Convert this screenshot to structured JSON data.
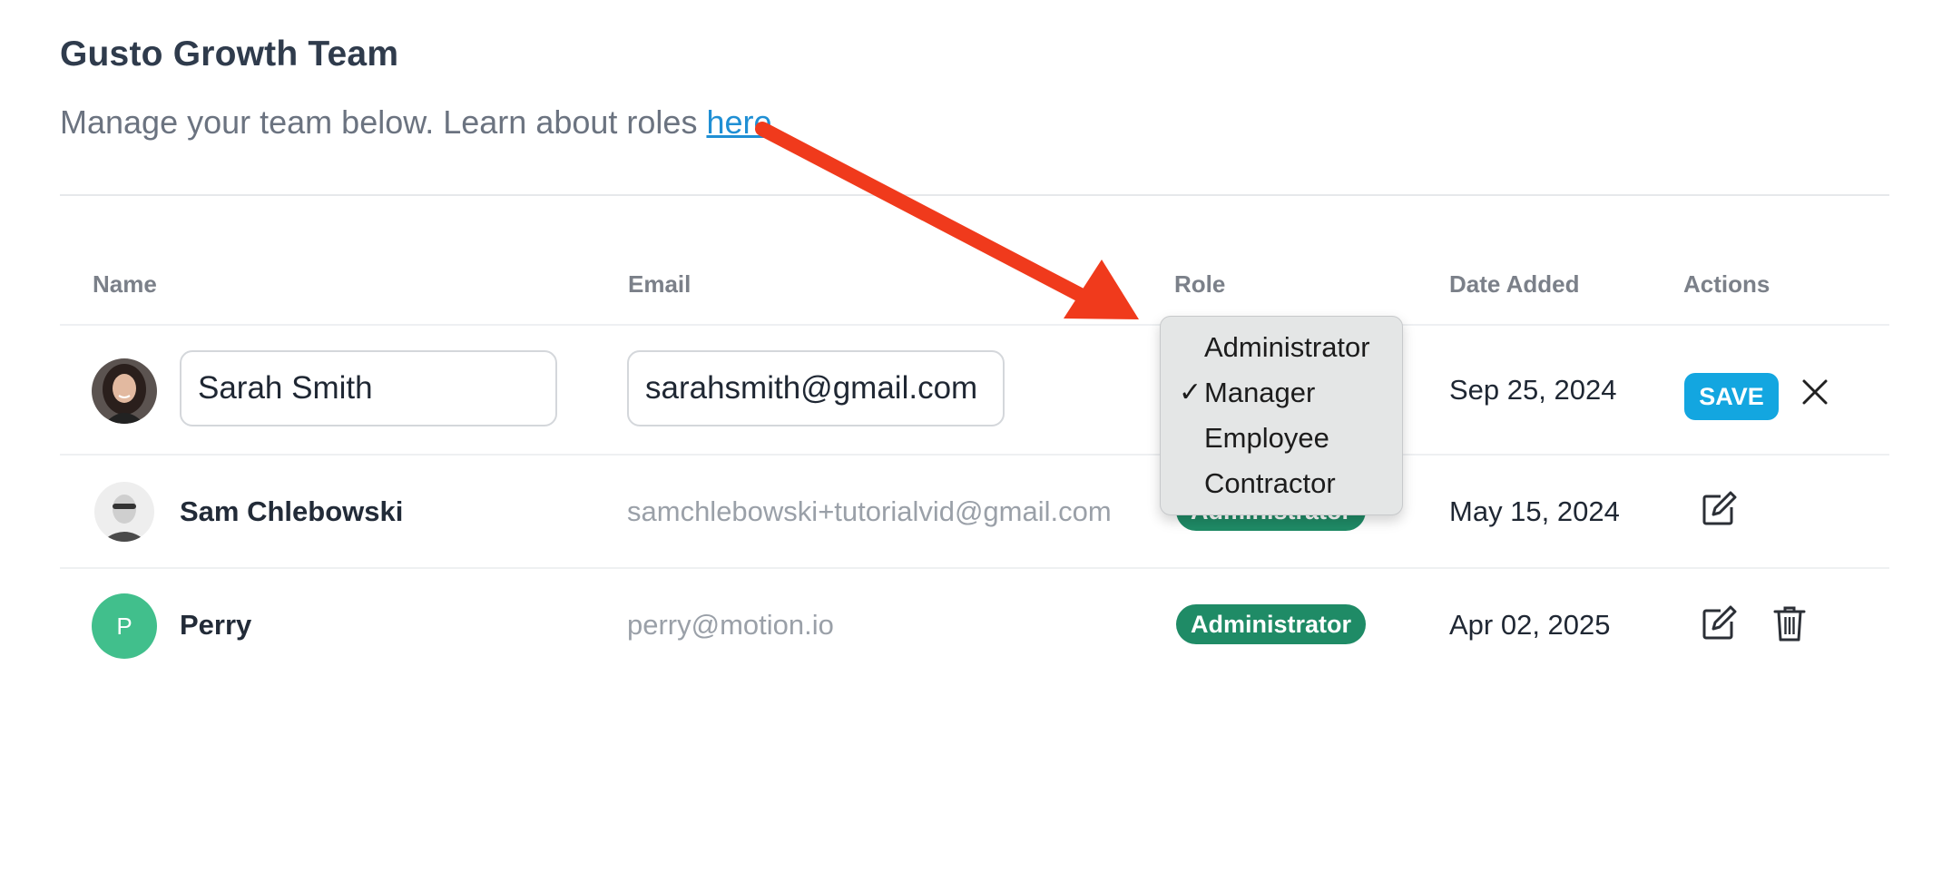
{
  "header": {
    "title": "Gusto Growth Team",
    "subtitle_prefix": "Manage your team below. Learn about roles ",
    "subtitle_link": "here."
  },
  "table": {
    "columns": [
      "Name",
      "Email",
      "Role",
      "Date Added",
      "Actions"
    ],
    "editing_row": {
      "name_value": "Sarah Smith",
      "email_value": "sarahsmith@gmail.com",
      "date": "Sep 25, 2024",
      "save_label": "SAVE"
    },
    "rows": [
      {
        "name": "Sam Chlebowski",
        "email": "samchlebowski+tutorialvid@gmail.com",
        "role": "Administrator",
        "date": "May 15, 2024"
      },
      {
        "name": "Perry",
        "avatar_initial": "P",
        "email": "perry@motion.io",
        "role": "Administrator",
        "date": "Apr 02, 2025"
      }
    ]
  },
  "role_dropdown": {
    "options": [
      "Administrator",
      "Manager",
      "Employee",
      "Contractor"
    ],
    "selected": "Manager",
    "check_mark": "✓"
  },
  "colors": {
    "badge": "#1f8b66",
    "save_button": "#13a6e0",
    "link": "#1f8fd4",
    "arrow_annotation": "#f03a1c",
    "avatar_perry": "#41bf8c"
  },
  "icons": {
    "close": "close-icon",
    "edit": "edit-icon",
    "delete": "trash-icon",
    "checkmark": "checkmark-icon"
  }
}
